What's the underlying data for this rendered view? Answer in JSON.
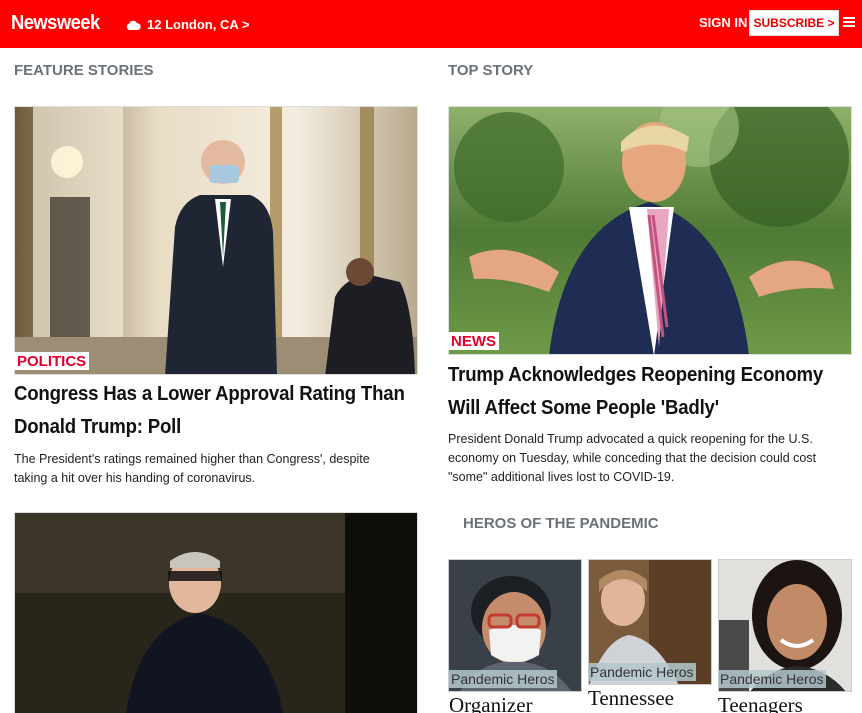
{
  "header": {
    "logo": "Newsweek",
    "weather": "12 London, CA >",
    "signin": "SIGN IN",
    "subscribe": "SUBSCRIBE >"
  },
  "feature": {
    "heading": "FEATURE STORIES",
    "story1": {
      "tag": "POLITICS",
      "headline_line1": "Congress Has a Lower Approval Rating Than",
      "headline_line2": "Donald Trump: Poll",
      "summary_line1": "The President's ratings remained higher than Congress', despite",
      "summary_line2": "taking a hit over his handing of coronavirus."
    }
  },
  "top": {
    "heading": "TOP STORY",
    "tag": "NEWS",
    "headline_line1": "Trump Acknowledges Reopening Economy",
    "headline_line2": "Will Affect Some People 'Badly'",
    "summary_line1": "President Donald Trump advocated a quick reopening for the U.S.",
    "summary_line2": "economy on Tuesday, while conceding that the decision could cost",
    "summary_line3": "\"some\" additional lives lost to COVID-19."
  },
  "heros": {
    "heading": "HEROS OF THE PANDEMIC",
    "cards": [
      {
        "tag": "Pandemic Heros",
        "name": "Organizer"
      },
      {
        "tag": "Pandemic Heros",
        "name": "Tennessee"
      },
      {
        "tag": "Pandemic Heros",
        "name": "Teenagers"
      }
    ]
  },
  "colors": {
    "brand": "#ff0000",
    "tag": "#e0002a",
    "section": "#6b717a"
  }
}
